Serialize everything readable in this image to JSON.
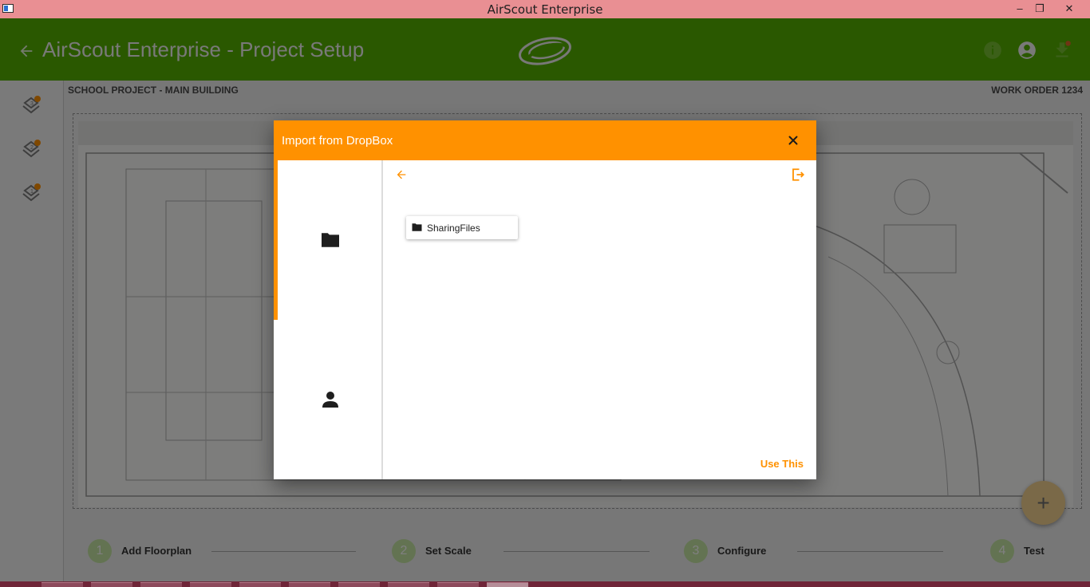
{
  "window": {
    "title": "AirScout Enterprise",
    "minimize": "–",
    "restore": "❐",
    "close": "✕"
  },
  "header": {
    "title": "AirScout Enterprise - Project Setup",
    "icons": [
      "back-arrow-icon",
      "info-icon",
      "account-circle-icon",
      "download-icon"
    ],
    "accent_color": "#55b100"
  },
  "rail": {
    "levels": [
      "3",
      "2",
      "1"
    ]
  },
  "project": {
    "name": "SCHOOL PROJECT - MAIN BUILDING",
    "work_order": "WORK ORDER 1234"
  },
  "fab": {
    "label": "+"
  },
  "stepper": {
    "steps": [
      {
        "number": "1",
        "label": "Add Floorplan"
      },
      {
        "number": "2",
        "label": "Set Scale"
      },
      {
        "number": "3",
        "label": "Configure"
      },
      {
        "number": "4",
        "label": "Test"
      }
    ]
  },
  "modal": {
    "title": "Import from DropBox",
    "accent_color": "#ff9100",
    "side_tabs": [
      "folder-icon",
      "person-icon"
    ],
    "items": [
      {
        "name": "SharingFiles",
        "type": "folder"
      }
    ],
    "use_label": "Use This"
  }
}
